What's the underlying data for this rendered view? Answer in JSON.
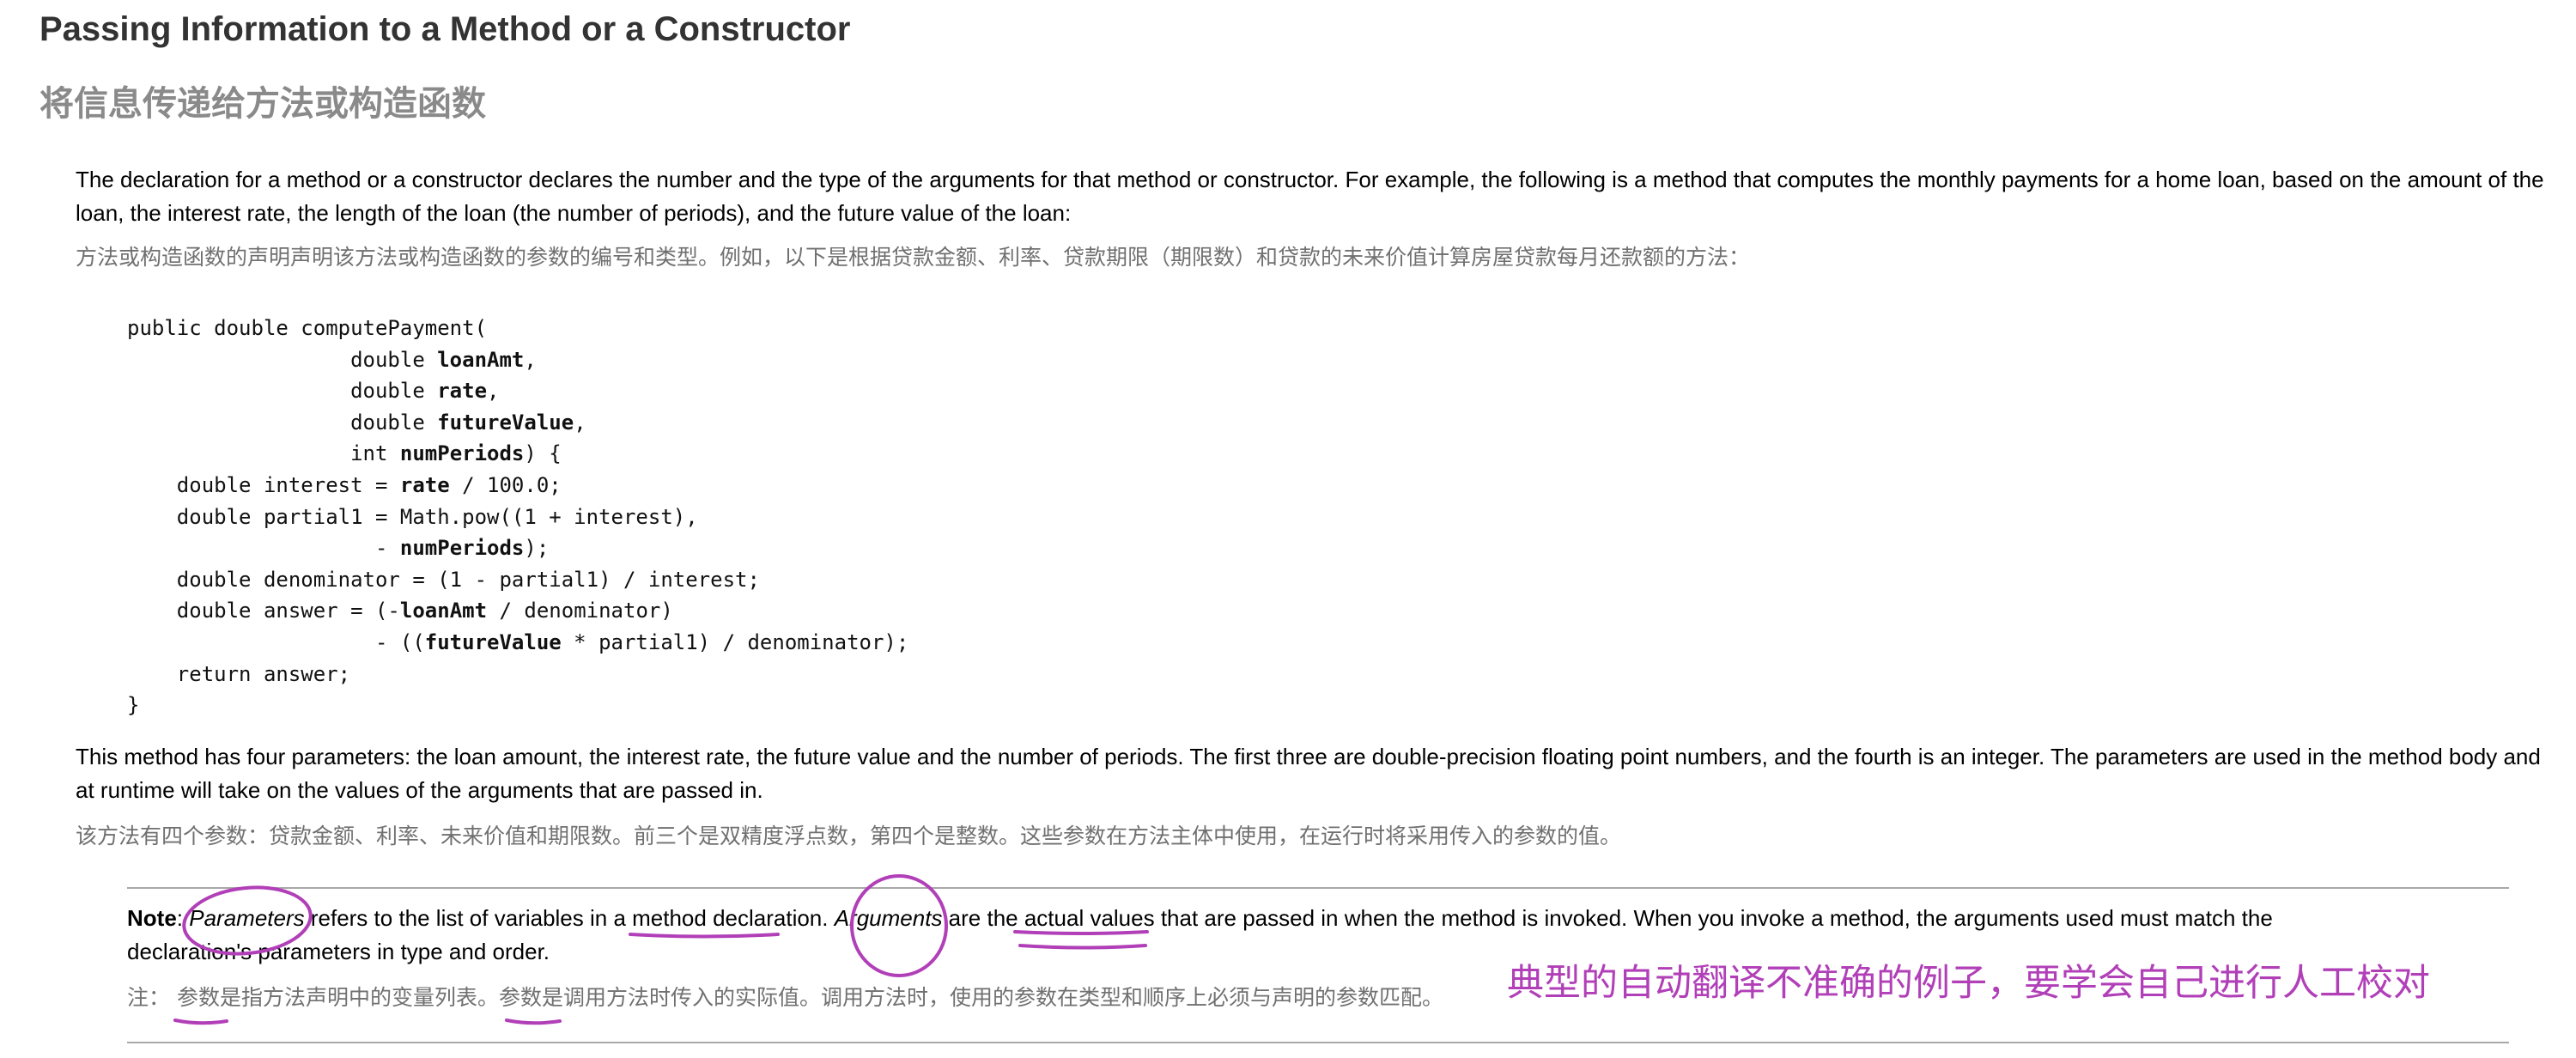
{
  "heading": {
    "en": "Passing Information to a Method or a Constructor",
    "zh": "将信息传递给方法或构造函数"
  },
  "intro": {
    "en": "The declaration for a method or a constructor declares the number and the type of the arguments for that method or constructor. For example, the following is a method that computes the monthly payments for a home loan, based on the amount of the loan, the interest rate, the length of the loan (the number of periods), and the future value of the loan:",
    "zh": "方法或构造函数的声明声明该方法或构造函数的参数的编号和类型。例如，以下是根据贷款金额、利率、贷款期限（期限数）和贷款的未来价值计算房屋贷款每月还款额的方法："
  },
  "code": {
    "lines": [
      [
        {
          "t": "public double computePayment("
        }
      ],
      [
        {
          "t": "                  double "
        },
        {
          "t": "loanAmt",
          "b": true
        },
        {
          "t": ","
        }
      ],
      [
        {
          "t": "                  double "
        },
        {
          "t": "rate",
          "b": true
        },
        {
          "t": ","
        }
      ],
      [
        {
          "t": "                  double "
        },
        {
          "t": "futureValue",
          "b": true
        },
        {
          "t": ","
        }
      ],
      [
        {
          "t": "                  int "
        },
        {
          "t": "numPeriods",
          "b": true
        },
        {
          "t": ") {"
        }
      ],
      [
        {
          "t": "    double interest = "
        },
        {
          "t": "rate",
          "b": true
        },
        {
          "t": " / 100.0;"
        }
      ],
      [
        {
          "t": "    double partial1 = Math.pow((1 + interest),"
        }
      ],
      [
        {
          "t": "                    - "
        },
        {
          "t": "numPeriods",
          "b": true
        },
        {
          "t": ");"
        }
      ],
      [
        {
          "t": "    double denominator = (1 - partial1) / interest;"
        }
      ],
      [
        {
          "t": "    double answer = (-"
        },
        {
          "t": "loanAmt",
          "b": true
        },
        {
          "t": " / denominator)"
        }
      ],
      [
        {
          "t": "                    - (("
        },
        {
          "t": "futureValue",
          "b": true
        },
        {
          "t": " * partial1) / denominator);"
        }
      ],
      [
        {
          "t": "    return answer;"
        }
      ],
      [
        {
          "t": "}"
        }
      ]
    ]
  },
  "explanation": {
    "en": "This method has four parameters: the loan amount, the interest rate, the future value and the number of periods. The first three are double-precision floating point numbers, and the fourth is an integer. The parameters are used in the method body and at runtime will take on the values of the arguments that are passed in.",
    "zh": "该方法有四个参数：贷款金额、利率、未来价值和期限数。前三个是双精度浮点数，第四个是整数。这些参数在方法主体中使用，在运行时将采用传入的参数的值。"
  },
  "note": {
    "label": "Note",
    "sep1": ": ",
    "parameters_term": "Parameters",
    "text1": " refers to the list of variables in a method declaration. ",
    "arguments_term": "Arguments",
    "text2": " are the actual values that are passed in when the method is invoked. When you invoke a method, the arguments used must match the declaration's parameters in type and order.",
    "zh": "注： 参数是指方法声明中的变量列表。参数是调用方法时传入的实际值。调用方法时，使用的参数在类型和顺序上必须与声明的参数匹配。"
  },
  "annotation": {
    "text": "典型的自动翻译不准确的例子，要学会自己进行人工校对",
    "color": "#b13fb8"
  }
}
